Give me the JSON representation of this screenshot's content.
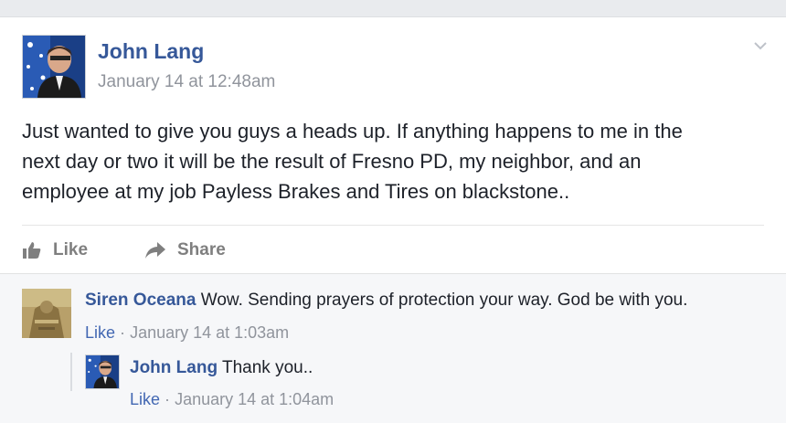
{
  "post": {
    "author": "John Lang",
    "timestamp": "January 14 at 12:48am",
    "lines": [
      "Just wanted to give you guys a heads up. If anything happens to me in the",
      "next day or two it will be the result of Fresno PD, my neighbor, and an",
      "employee at my job Payless Brakes and Tires on blackstone.."
    ]
  },
  "actions": {
    "like": "Like",
    "share": "Share"
  },
  "comments": [
    {
      "author": "Siren Oceana",
      "text": "Wow. Sending prayers of protection your way. God be with you.",
      "like": "Like",
      "separator": "·",
      "time": "January 14 at 1:03am"
    },
    {
      "author": "John Lang",
      "text": "Thank you..",
      "like": "Like",
      "separator": "·",
      "time": "January 14 at 1:04am"
    }
  ],
  "colors": {
    "link": "#365899",
    "meta": "#90949c",
    "action": "#7f7f7f",
    "text": "#1d2129"
  }
}
